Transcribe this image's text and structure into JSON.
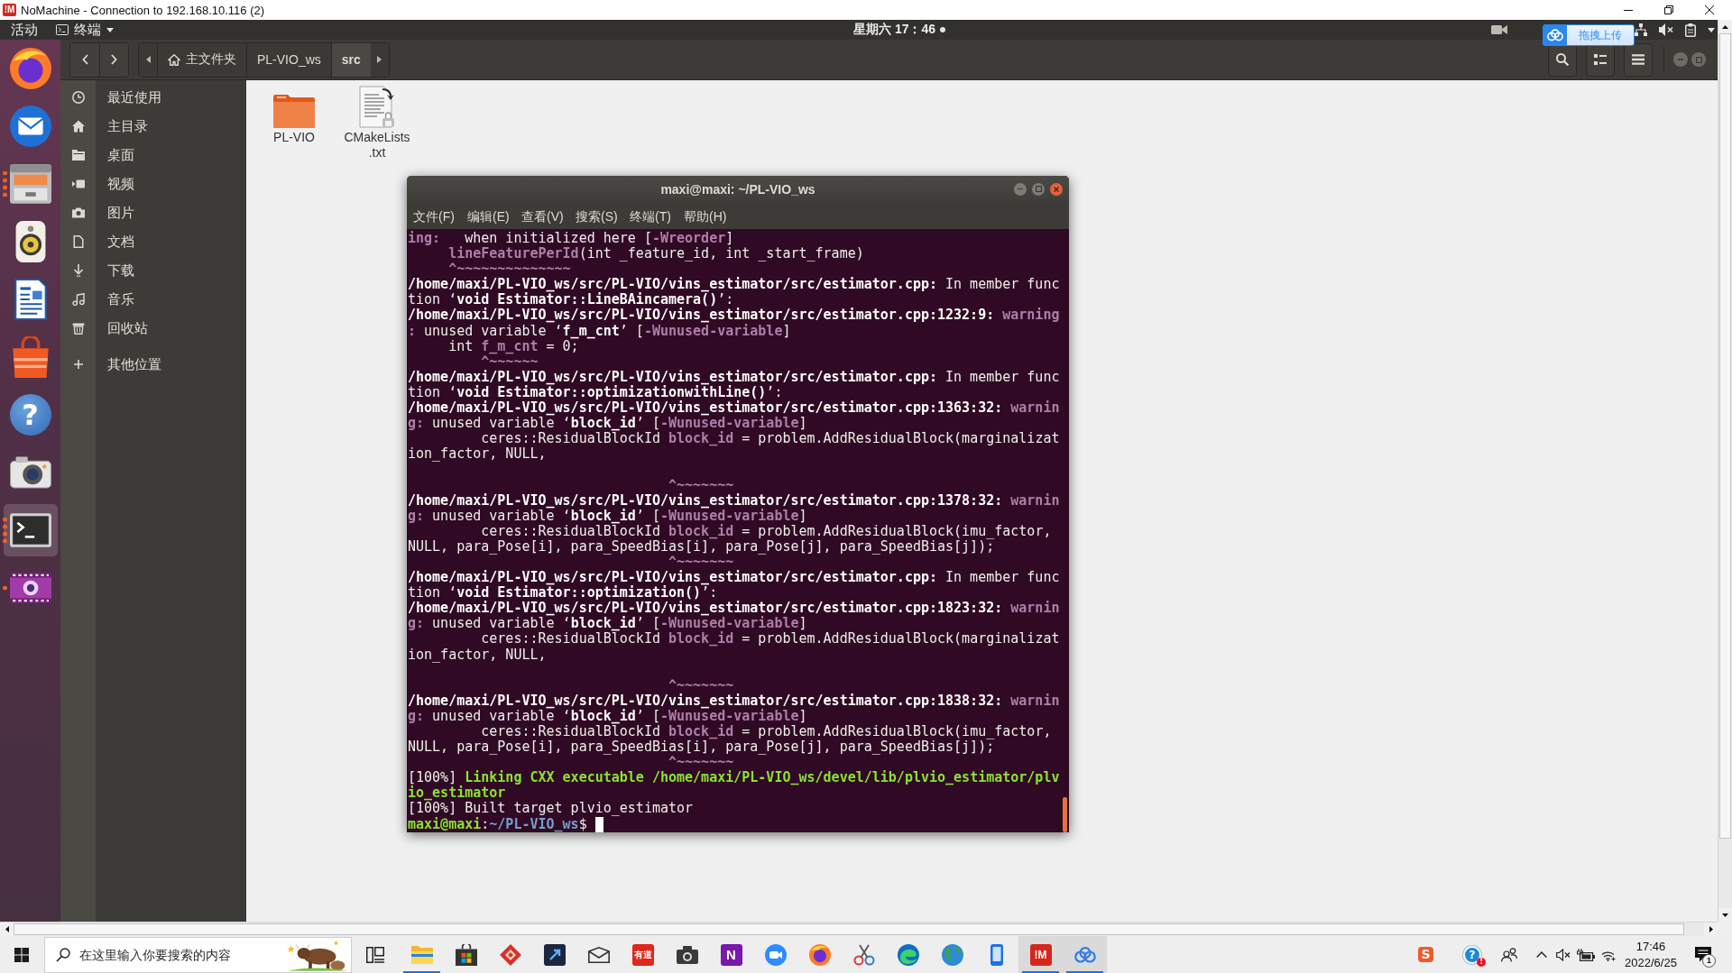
{
  "nomachine": {
    "logo_text": "!M",
    "title": "NoMachine - Connection to 192.168.10.116 (2)"
  },
  "top_panel": {
    "activities": "活动",
    "app_menu": "终端",
    "clock": "星期六 17：46",
    "notification_dot": true
  },
  "upload_widget": {
    "label": "拖拽上传"
  },
  "dock": [
    {
      "kind": "browser",
      "running": false,
      "multiple": false,
      "active": false
    },
    {
      "kind": "mail",
      "running": false,
      "multiple": false,
      "active": false
    },
    {
      "kind": "files",
      "running": true,
      "multiple": true,
      "active": false
    },
    {
      "kind": "music",
      "running": false,
      "multiple": false,
      "active": false
    },
    {
      "kind": "writer",
      "running": false,
      "multiple": false,
      "active": false
    },
    {
      "kind": "store",
      "running": false,
      "multiple": false,
      "active": false
    },
    {
      "kind": "help",
      "glyph": "?",
      "running": false,
      "multiple": false,
      "active": false
    },
    {
      "kind": "camera",
      "running": false,
      "multiple": false,
      "active": false
    },
    {
      "kind": "terminal",
      "running": true,
      "multiple": true,
      "active": true
    },
    {
      "kind": "recorder",
      "running": true,
      "multiple": false,
      "active": false
    }
  ],
  "file_manager": {
    "path_bar": [
      {
        "label": "主文件夹",
        "kind": "home",
        "selected": false
      },
      {
        "label": "PL-VIO_ws",
        "kind": "folder",
        "selected": false
      },
      {
        "label": "src",
        "kind": "folder",
        "selected": true
      }
    ],
    "sidebar": [
      {
        "label": "最近使用",
        "kind": "recent"
      },
      {
        "label": "主目录",
        "kind": "home"
      },
      {
        "label": "桌面",
        "kind": "desktop"
      },
      {
        "label": "视频",
        "kind": "videos"
      },
      {
        "label": "图片",
        "kind": "pictures"
      },
      {
        "label": "文档",
        "kind": "documents"
      },
      {
        "label": "下载",
        "kind": "downloads"
      },
      {
        "label": "音乐",
        "kind": "music"
      },
      {
        "label": "回收站",
        "kind": "trash"
      },
      {
        "label": "其他位置",
        "kind": "other"
      }
    ],
    "files": [
      {
        "name": "PL-VIO",
        "kind": "folder"
      },
      {
        "name": "CMakeLists.txt",
        "kind": "link"
      }
    ]
  },
  "terminal": {
    "title": "maxi@maxi: ~/PL-VIO_ws",
    "menu": [
      "文件(F)",
      "编辑(E)",
      "查看(V)",
      "搜索(S)",
      "终端(T)",
      "帮助(H)"
    ],
    "lines": [
      {
        "kind": "output",
        "spans": [
          {
            "text": "ing:",
            "kind": "warn"
          },
          {
            "text": "   when initialized here [",
            "kind": "plain"
          },
          {
            "text": "-Wreorder",
            "kind": "warn"
          },
          {
            "text": "]",
            "kind": "plain"
          }
        ]
      },
      {
        "kind": "output",
        "spans": [
          {
            "text": "     lineFeaturePerId",
            "kind": "warn"
          },
          {
            "text": "(int _feature_id, int _start_frame)",
            "kind": "plain"
          }
        ]
      },
      {
        "kind": "output",
        "spans": [
          {
            "text": "     ^~~~~~~~~~~~~~~",
            "kind": "warn"
          }
        ]
      },
      {
        "kind": "output",
        "spans": [
          {
            "text": "/home/maxi/PL-VIO_ws/src/PL-VIO/vins_estimator/src/estimator.cpp:",
            "kind": "bold"
          },
          {
            "text": " In member func",
            "kind": "plain"
          }
        ]
      },
      {
        "kind": "output",
        "spans": [
          {
            "text": "tion ‘",
            "kind": "plain"
          },
          {
            "text": "void Estimator::LineBAincamera()",
            "kind": "bold"
          },
          {
            "text": "’:",
            "kind": "plain"
          }
        ]
      },
      {
        "kind": "output",
        "spans": [
          {
            "text": "/home/maxi/PL-VIO_ws/src/PL-VIO/vins_estimator/src/estimator.cpp:1232:9:",
            "kind": "bold"
          },
          {
            "text": " warning",
            "kind": "warn"
          }
        ]
      },
      {
        "kind": "output",
        "spans": [
          {
            "text": ":",
            "kind": "warn"
          },
          {
            "text": " unused variable ‘",
            "kind": "plain"
          },
          {
            "text": "f_m_cnt",
            "kind": "bold"
          },
          {
            "text": "’ [",
            "kind": "plain"
          },
          {
            "text": "-Wunused-variable",
            "kind": "warn"
          },
          {
            "text": "]",
            "kind": "plain"
          }
        ]
      },
      {
        "kind": "output",
        "spans": [
          {
            "text": "     int ",
            "kind": "plain"
          },
          {
            "text": "f_m_cnt",
            "kind": "warn"
          },
          {
            "text": " = 0;",
            "kind": "plain"
          }
        ]
      },
      {
        "kind": "output",
        "spans": [
          {
            "text": "         ^~~~~~~",
            "kind": "warn"
          }
        ]
      },
      {
        "kind": "output",
        "spans": [
          {
            "text": "/home/maxi/PL-VIO_ws/src/PL-VIO/vins_estimator/src/estimator.cpp:",
            "kind": "bold"
          },
          {
            "text": " In member func",
            "kind": "plain"
          }
        ]
      },
      {
        "kind": "output",
        "spans": [
          {
            "text": "tion ‘",
            "kind": "plain"
          },
          {
            "text": "void Estimator::optimizationwithLine()",
            "kind": "bold"
          },
          {
            "text": "’:",
            "kind": "plain"
          }
        ]
      },
      {
        "kind": "output",
        "spans": [
          {
            "text": "/home/maxi/PL-VIO_ws/src/PL-VIO/vins_estimator/src/estimator.cpp:1363:32:",
            "kind": "bold"
          },
          {
            "text": " warnin",
            "kind": "warn"
          }
        ]
      },
      {
        "kind": "output",
        "spans": [
          {
            "text": "g:",
            "kind": "warn"
          },
          {
            "text": " unused variable ‘",
            "kind": "plain"
          },
          {
            "text": "block_id",
            "kind": "bold"
          },
          {
            "text": "’ [",
            "kind": "plain"
          },
          {
            "text": "-Wunused-variable",
            "kind": "warn"
          },
          {
            "text": "]",
            "kind": "plain"
          }
        ]
      },
      {
        "kind": "output",
        "spans": [
          {
            "text": "         ceres::ResidualBlockId ",
            "kind": "plain"
          },
          {
            "text": "block_id",
            "kind": "warn"
          },
          {
            "text": " = problem.AddResidualBlock(marginalizat",
            "kind": "plain"
          }
        ]
      },
      {
        "kind": "output",
        "spans": [
          {
            "text": "ion_factor, NULL,",
            "kind": "plain"
          }
        ]
      },
      {
        "kind": "blank"
      },
      {
        "kind": "output",
        "spans": [
          {
            "text": "                                ^~~~~~~~",
            "kind": "warn"
          }
        ]
      },
      {
        "kind": "output",
        "spans": [
          {
            "text": "/home/maxi/PL-VIO_ws/src/PL-VIO/vins_estimator/src/estimator.cpp:1378:32:",
            "kind": "bold"
          },
          {
            "text": " warnin",
            "kind": "warn"
          }
        ]
      },
      {
        "kind": "output",
        "spans": [
          {
            "text": "g:",
            "kind": "warn"
          },
          {
            "text": " unused variable ‘",
            "kind": "plain"
          },
          {
            "text": "block_id",
            "kind": "bold"
          },
          {
            "text": "’ [",
            "kind": "plain"
          },
          {
            "text": "-Wunused-variable",
            "kind": "warn"
          },
          {
            "text": "]",
            "kind": "plain"
          }
        ]
      },
      {
        "kind": "output",
        "spans": [
          {
            "text": "         ceres::ResidualBlockId ",
            "kind": "plain"
          },
          {
            "text": "block_id",
            "kind": "warn"
          },
          {
            "text": " = problem.AddResidualBlock(imu_factor,",
            "kind": "plain"
          }
        ]
      },
      {
        "kind": "output",
        "spans": [
          {
            "text": "NULL, para_Pose[i], para_SpeedBias[i], para_Pose[j], para_SpeedBias[j]);",
            "kind": "plain"
          }
        ]
      },
      {
        "kind": "output",
        "spans": [
          {
            "text": "                                ^~~~~~~~",
            "kind": "warn"
          }
        ]
      },
      {
        "kind": "output",
        "spans": [
          {
            "text": "/home/maxi/PL-VIO_ws/src/PL-VIO/vins_estimator/src/estimator.cpp:",
            "kind": "bold"
          },
          {
            "text": " In member func",
            "kind": "plain"
          }
        ]
      },
      {
        "kind": "output",
        "spans": [
          {
            "text": "tion ‘",
            "kind": "plain"
          },
          {
            "text": "void Estimator::optimization()",
            "kind": "bold"
          },
          {
            "text": "’:",
            "kind": "plain"
          }
        ]
      },
      {
        "kind": "output",
        "spans": [
          {
            "text": "/home/maxi/PL-VIO_ws/src/PL-VIO/vins_estimator/src/estimator.cpp:1823:32:",
            "kind": "bold"
          },
          {
            "text": " warnin",
            "kind": "warn"
          }
        ]
      },
      {
        "kind": "output",
        "spans": [
          {
            "text": "g:",
            "kind": "warn"
          },
          {
            "text": " unused variable ‘",
            "kind": "plain"
          },
          {
            "text": "block_id",
            "kind": "bold"
          },
          {
            "text": "’ [",
            "kind": "plain"
          },
          {
            "text": "-Wunused-variable",
            "kind": "warn"
          },
          {
            "text": "]",
            "kind": "plain"
          }
        ]
      },
      {
        "kind": "output",
        "spans": [
          {
            "text": "         ceres::ResidualBlockId ",
            "kind": "plain"
          },
          {
            "text": "block_id",
            "kind": "warn"
          },
          {
            "text": " = problem.AddResidualBlock(marginalizat",
            "kind": "plain"
          }
        ]
      },
      {
        "kind": "output",
        "spans": [
          {
            "text": "ion_factor, NULL,",
            "kind": "plain"
          }
        ]
      },
      {
        "kind": "blank"
      },
      {
        "kind": "output",
        "spans": [
          {
            "text": "                                ^~~~~~~~",
            "kind": "warn"
          }
        ]
      },
      {
        "kind": "output",
        "spans": [
          {
            "text": "/home/maxi/PL-VIO_ws/src/PL-VIO/vins_estimator/src/estimator.cpp:1838:32:",
            "kind": "bold"
          },
          {
            "text": " warnin",
            "kind": "warn"
          }
        ]
      },
      {
        "kind": "output",
        "spans": [
          {
            "text": "g:",
            "kind": "warn"
          },
          {
            "text": " unused variable ‘",
            "kind": "plain"
          },
          {
            "text": "block_id",
            "kind": "bold"
          },
          {
            "text": "’ [",
            "kind": "plain"
          },
          {
            "text": "-Wunused-variable",
            "kind": "warn"
          },
          {
            "text": "]",
            "kind": "plain"
          }
        ]
      },
      {
        "kind": "output",
        "spans": [
          {
            "text": "         ceres::ResidualBlockId ",
            "kind": "plain"
          },
          {
            "text": "block_id",
            "kind": "warn"
          },
          {
            "text": " = problem.AddResidualBlock(imu_factor,",
            "kind": "plain"
          }
        ]
      },
      {
        "kind": "output",
        "spans": [
          {
            "text": "NULL, para_Pose[i], para_SpeedBias[i], para_Pose[j], para_SpeedBias[j]);",
            "kind": "plain"
          }
        ]
      },
      {
        "kind": "output",
        "spans": [
          {
            "text": "                                ^~~~~~~~",
            "kind": "warn"
          }
        ]
      },
      {
        "kind": "output",
        "spans": [
          {
            "text": "[100%] ",
            "kind": "plain"
          },
          {
            "text": "Linking CXX executable /home/maxi/PL-VIO_ws/devel/lib/plvio_estimator/plv",
            "kind": "green"
          }
        ]
      },
      {
        "kind": "output",
        "spans": [
          {
            "text": "io_estimator",
            "kind": "green"
          }
        ]
      },
      {
        "kind": "output",
        "spans": [
          {
            "text": "[100%] Built target plvio_estimator",
            "kind": "plain"
          }
        ]
      },
      {
        "kind": "prompt",
        "cursor": true,
        "spans": [
          {
            "text": "maxi@maxi",
            "kind": "green"
          },
          {
            "text": ":",
            "kind": "plain"
          },
          {
            "text": "~/PL-VIO_ws",
            "kind": "blue"
          },
          {
            "text": "$",
            "kind": "plain"
          }
        ]
      }
    ]
  },
  "taskbar": {
    "search": {
      "placeholder": "在这里输入你要搜索的内容"
    },
    "apps": [
      {
        "kind": "explorer",
        "running": true,
        "active": false
      },
      {
        "kind": "store",
        "running": false,
        "active": false
      },
      {
        "kind": "diamond",
        "running": false,
        "active": false
      },
      {
        "kind": "dev",
        "running": false,
        "active": false
      },
      {
        "kind": "mail",
        "running": false,
        "active": false
      },
      {
        "kind": "dict",
        "logo_text": "有道",
        "running": false,
        "active": false
      },
      {
        "kind": "camera",
        "running": false,
        "active": false
      },
      {
        "kind": "notes",
        "logo_text": "N",
        "running": false,
        "active": false
      },
      {
        "kind": "meeting",
        "running": false,
        "active": false
      },
      {
        "kind": "browser",
        "running": false,
        "active": false
      },
      {
        "kind": "snip",
        "running": false,
        "active": false
      },
      {
        "kind": "edge",
        "running": false,
        "active": false
      },
      {
        "kind": "globe",
        "running": false,
        "active": false
      },
      {
        "kind": "phone",
        "running": false,
        "active": false
      },
      {
        "kind": "remote",
        "logo_text": "!M",
        "running": true,
        "active": true
      },
      {
        "kind": "cloud",
        "running": true,
        "active": true
      }
    ],
    "tray": [
      {
        "kind": "ime",
        "logo_text": "S"
      },
      {
        "kind": "help",
        "glyph": "?",
        "badge": "!"
      },
      {
        "kind": "people"
      },
      {
        "kind": "overflow"
      },
      {
        "kind": "volume"
      },
      {
        "kind": "battery"
      },
      {
        "kind": "wifi"
      }
    ],
    "clock": {
      "time": "17:46",
      "date": "2022/6/25"
    },
    "notifications": "1"
  }
}
